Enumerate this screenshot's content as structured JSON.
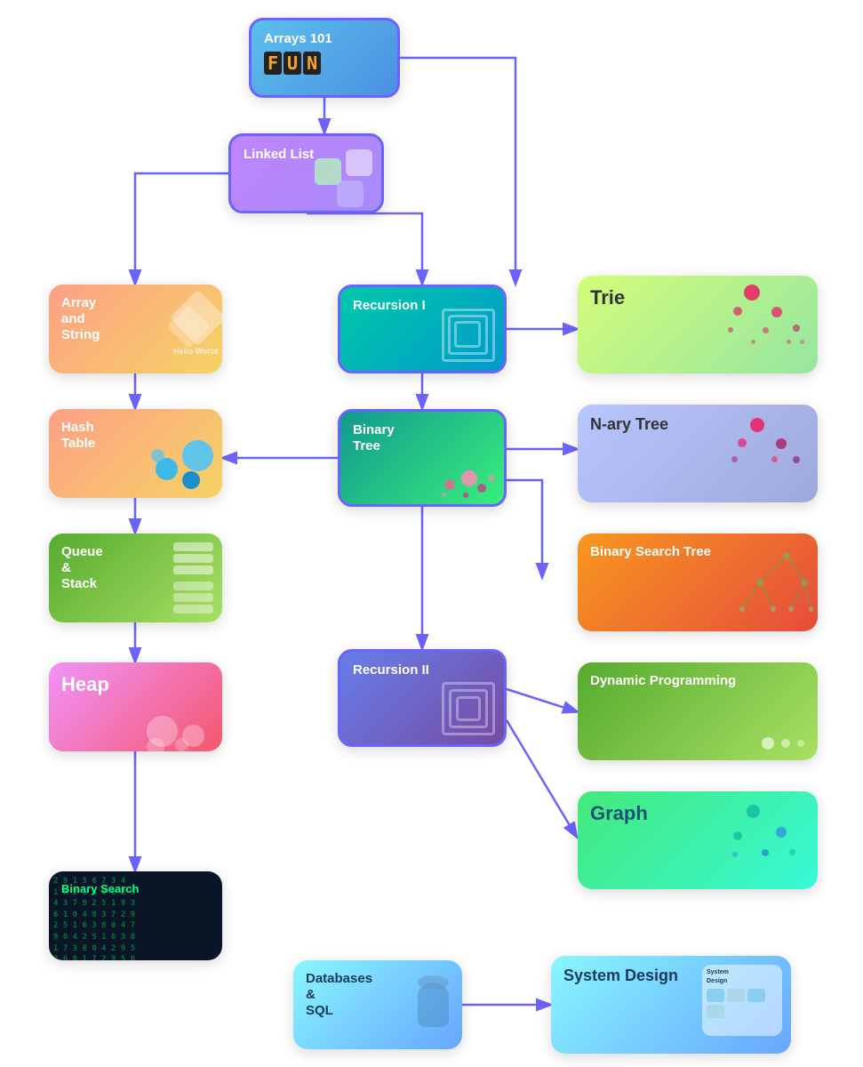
{
  "nodes": {
    "arrays101": {
      "label": "Arrays 101",
      "fun_text": "FUN"
    },
    "linkedlist": {
      "label": "Linked List"
    },
    "arraystring": {
      "label": "Array and String",
      "sublabel": "Hello World"
    },
    "recursion1": {
      "label": "Recursion I"
    },
    "hashtable": {
      "label": "Hash Table"
    },
    "binarytree": {
      "label": "Binary Tree"
    },
    "trie": {
      "label": "Trie"
    },
    "narytree": {
      "label": "N-ary Tree"
    },
    "queuestack": {
      "label": "Queue & Stack"
    },
    "bst": {
      "label": "Binary Search Tree"
    },
    "heap": {
      "label": "Heap"
    },
    "recursion2": {
      "label": "Recursion II"
    },
    "dynprog": {
      "label": "Dynamic Programming"
    },
    "graph": {
      "label": "Graph"
    },
    "binarysearch": {
      "label": "Binary Search"
    },
    "databases": {
      "label": "Databases & SQL"
    },
    "systemdesign": {
      "label": "System Design"
    }
  },
  "colors": {
    "connector": "#6c63ff",
    "connector_arrow": "#6c63ff"
  }
}
